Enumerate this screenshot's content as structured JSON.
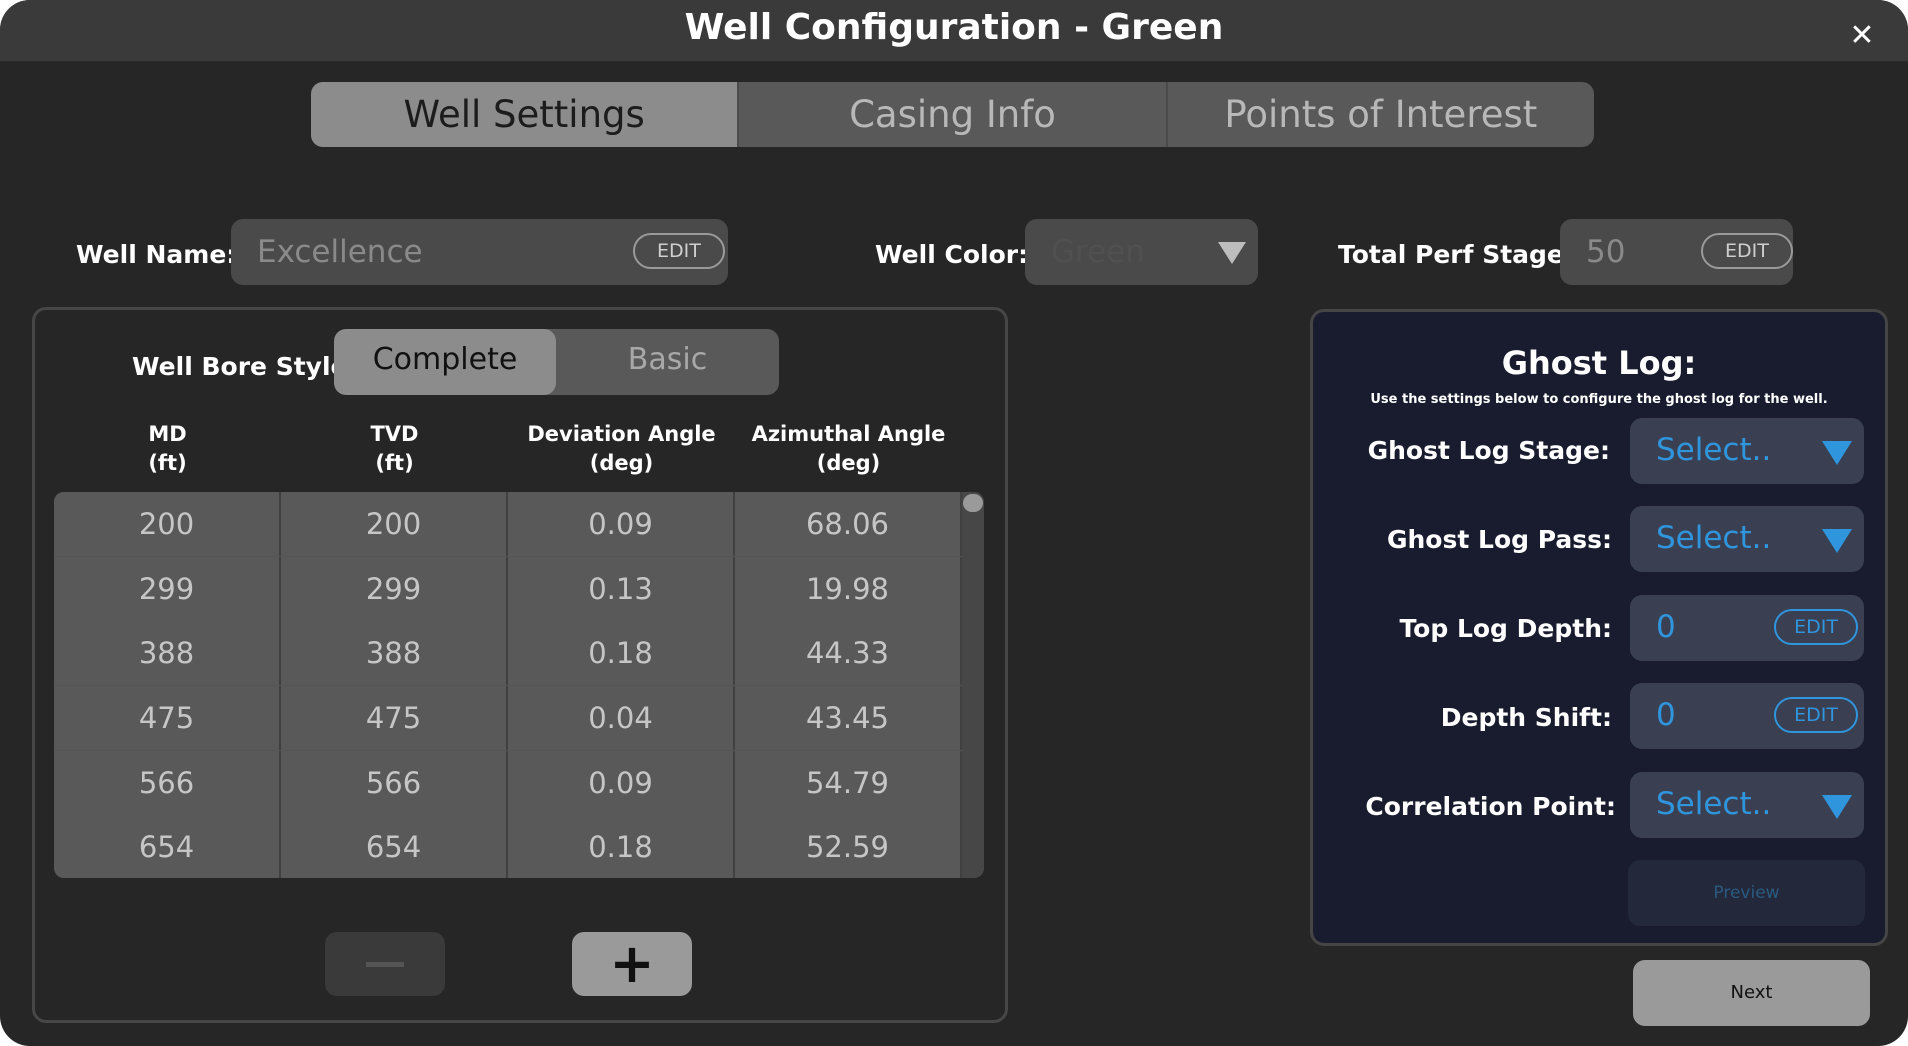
{
  "window": {
    "title": "Well Configuration - Green",
    "close_label": "✕"
  },
  "tabs": [
    {
      "label": "Well Settings",
      "active": true
    },
    {
      "label": "Casing Info",
      "active": false
    },
    {
      "label": "Points of Interest",
      "active": false
    }
  ],
  "well_name": {
    "label": "Well Name:",
    "value": "Excellence",
    "edit_label": "EDIT"
  },
  "well_color": {
    "label": "Well Color:",
    "value": "Green"
  },
  "total_perf": {
    "label": "Total Perf Stages:",
    "value": "50",
    "edit_label": "EDIT"
  },
  "wellbore": {
    "label": "Well Bore Style:",
    "options": [
      "Complete",
      "Basic"
    ],
    "selected": "Complete"
  },
  "table": {
    "headers": [
      {
        "line1": "MD",
        "line2": "(ft)"
      },
      {
        "line1": "TVD",
        "line2": "(ft)"
      },
      {
        "line1": "Deviation Angle",
        "line2": "(deg)"
      },
      {
        "line1": "Azimuthal Angle",
        "line2": "(deg)"
      }
    ],
    "rows": [
      [
        "200",
        "200",
        "0.09",
        "68.06"
      ],
      [
        "299",
        "299",
        "0.13",
        "19.98"
      ],
      [
        "388",
        "388",
        "0.18",
        "44.33"
      ],
      [
        "475",
        "475",
        "0.04",
        "43.45"
      ],
      [
        "566",
        "566",
        "0.09",
        "54.79"
      ],
      [
        "654",
        "654",
        "0.18",
        "52.59"
      ]
    ],
    "add_label": "+",
    "remove_label": ""
  },
  "ghost_log": {
    "title": "Ghost Log:",
    "subtitle": "Use the settings below to configure the ghost log for the well.",
    "stage": {
      "label": "Ghost Log Stage:",
      "value": "Select.."
    },
    "pass": {
      "label": "Ghost Log Pass:",
      "value": "Select.."
    },
    "top_depth": {
      "label": "Top Log Depth:",
      "value": "0",
      "edit_label": "EDIT"
    },
    "depth_shift": {
      "label": "Depth Shift:",
      "value": "0",
      "edit_label": "EDIT"
    },
    "correlation": {
      "label": "Correlation Point:",
      "value": "Select.."
    },
    "preview_label": "Preview"
  },
  "next_label": "Next",
  "colors": {
    "background": "#262626",
    "accent_blue": "#2f95dc",
    "ghost_panel": "#181c2e",
    "active_tab": "#8c8c8c"
  }
}
